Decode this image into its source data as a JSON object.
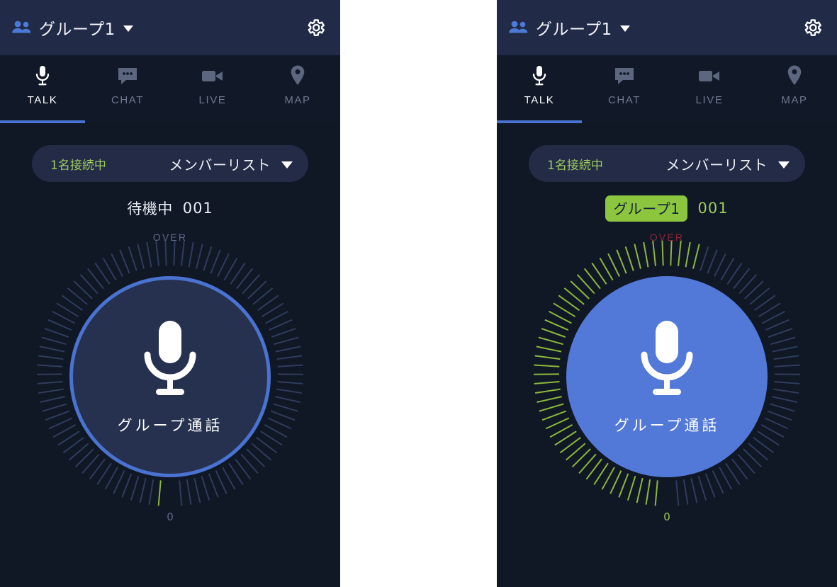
{
  "header": {
    "group_label": "グループ1",
    "people_icon": "people-icon",
    "chevron_icon": "chevron-down-icon",
    "settings_icon": "gear-icon"
  },
  "tabs": [
    {
      "label": "TALK",
      "icon": "microphone-icon",
      "active": true
    },
    {
      "label": "CHAT",
      "icon": "chat-bubble-icon",
      "active": false
    },
    {
      "label": "LIVE",
      "icon": "video-camera-icon",
      "active": false
    },
    {
      "label": "MAP",
      "icon": "map-pin-icon",
      "active": false
    }
  ],
  "member_chip": {
    "connected_count": "1名接続中",
    "list_label": "メンバーリスト",
    "chevron_icon": "chevron-down-icon"
  },
  "panel_left": {
    "status_text": "待機中",
    "member_id": "001",
    "dial": {
      "over_label": "OVER",
      "zero_label": "0",
      "ptt_label": "グループ通話",
      "mic_icon": "microphone-icon",
      "state": "idle",
      "meter_level_percent": 0
    }
  },
  "panel_right": {
    "group_badge": "グループ1",
    "member_id": "001",
    "dial": {
      "over_label": "OVER",
      "zero_label": "0",
      "ptt_label": "グループ通話",
      "mic_icon": "microphone-icon",
      "state": "active",
      "meter_level_percent": 55
    }
  },
  "colors": {
    "appbar_bg": "#212a47",
    "body_bg": "#101725",
    "accent_blue": "#4a72d0",
    "active_blue": "#5278d8",
    "accent_green": "#9fcb5e",
    "badge_green": "#8cc63f",
    "over_red": "#8d2738",
    "tick_idle": "#2f3c5e",
    "tick_active": "#8cb83c",
    "muted_text": "#6f7890"
  }
}
